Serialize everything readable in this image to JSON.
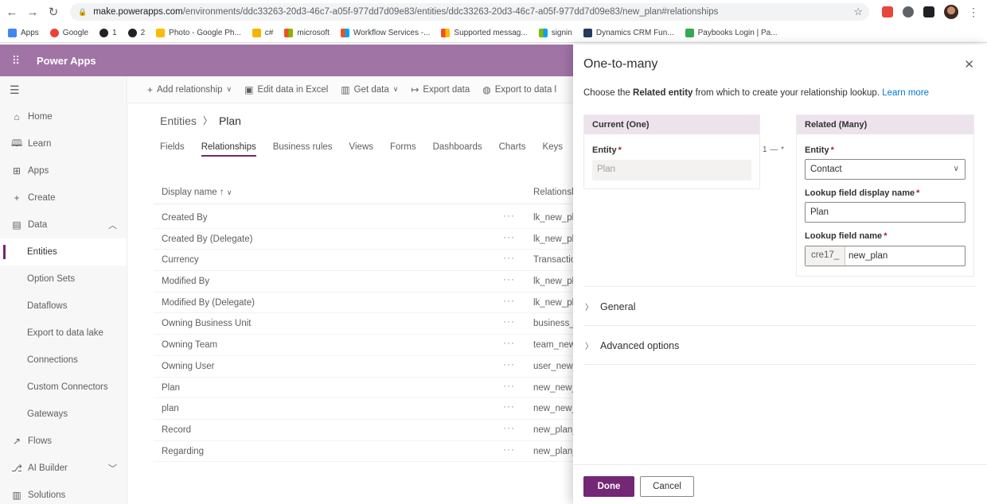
{
  "browser": {
    "url_host": "make.powerapps.com",
    "url_path": "/environments/ddc33263-20d3-46c7-a05f-977dd7d09e83/entities/ddc33263-20d3-46c7-a05f-977dd7d09e83/new_plan#relationships",
    "bookmarks": [
      "Apps",
      "Google",
      "1",
      "2",
      "Photo - Google Ph...",
      "c#",
      "microsoft",
      "Workflow Services -...",
      "Supported messag...",
      "signin",
      "Dynamics CRM Fun...",
      "Paybooks Login | Pa..."
    ]
  },
  "header": {
    "title": "Power Apps"
  },
  "sidebar": {
    "items": [
      {
        "label": "Home",
        "icon": "home-icon",
        "glyph": "⌂"
      },
      {
        "label": "Learn",
        "icon": "book-icon",
        "glyph": "🕮"
      },
      {
        "label": "Apps",
        "icon": "apps-icon",
        "glyph": "⊞"
      },
      {
        "label": "Create",
        "icon": "plus-icon",
        "glyph": "+"
      },
      {
        "label": "Data",
        "icon": "database-icon",
        "glyph": "▤"
      },
      {
        "label": "Entities"
      },
      {
        "label": "Option Sets"
      },
      {
        "label": "Dataflows"
      },
      {
        "label": "Export to data lake"
      },
      {
        "label": "Connections"
      },
      {
        "label": "Custom Connectors"
      },
      {
        "label": "Gateways"
      },
      {
        "label": "Flows",
        "icon": "flow-icon",
        "glyph": "↗"
      },
      {
        "label": "AI Builder",
        "icon": "ai-builder-icon",
        "glyph": "⎇"
      },
      {
        "label": "Solutions",
        "icon": "solutions-icon",
        "glyph": "▥"
      }
    ]
  },
  "commandbar": {
    "add_relationship": "Add relationship",
    "edit_excel": "Edit data in Excel",
    "get_data": "Get data",
    "export_data": "Export data",
    "export_lake": "Export to data l"
  },
  "breadcrumb": {
    "parent": "Entities",
    "current": "Plan"
  },
  "tabs": [
    "Fields",
    "Relationships",
    "Business rules",
    "Views",
    "Forms",
    "Dashboards",
    "Charts",
    "Keys",
    "D"
  ],
  "grid": {
    "col_name": "Display name ↑",
    "col_rel": "Relationsl",
    "rows": [
      {
        "name": "Created By",
        "rel": "lk_new_plan"
      },
      {
        "name": "Created By (Delegate)",
        "rel": "lk_new_plan"
      },
      {
        "name": "Currency",
        "rel": "Transaction"
      },
      {
        "name": "Modified By",
        "rel": "lk_new_plan"
      },
      {
        "name": "Modified By (Delegate)",
        "rel": "lk_new_plan"
      },
      {
        "name": "Owning Business Unit",
        "rel": "business_u"
      },
      {
        "name": "Owning Team",
        "rel": "team_new_"
      },
      {
        "name": "Owning User",
        "rel": "user_new_"
      },
      {
        "name": "Plan",
        "rel": "new_new_p"
      },
      {
        "name": "plan",
        "rel": "new_new_p"
      },
      {
        "name": "Record",
        "rel": "new_plan_"
      },
      {
        "name": "Regarding",
        "rel": "new_plan_"
      }
    ],
    "row_menu": "···"
  },
  "panel": {
    "title": "One-to-many",
    "close": "✕",
    "desc_pre": "Choose the ",
    "desc_bold": "Related entity",
    "desc_post": " from which to create your relationship lookup. ",
    "learn_more": "Learn more",
    "current_header": "Current (One)",
    "related_header": "Related (Many)",
    "entity_label": "Entity",
    "required_mark": "*",
    "current_entity": "Plan",
    "connector": "1 — *",
    "related_entity": "Contact",
    "lookup_display_label": "Lookup field display name",
    "lookup_display_value": "Plan",
    "lookup_name_label": "Lookup field name",
    "lookup_prefix": "cre17_",
    "lookup_name_value": "new_plan",
    "general": "General",
    "advanced": "Advanced options",
    "done": "Done",
    "cancel": "Cancel"
  }
}
